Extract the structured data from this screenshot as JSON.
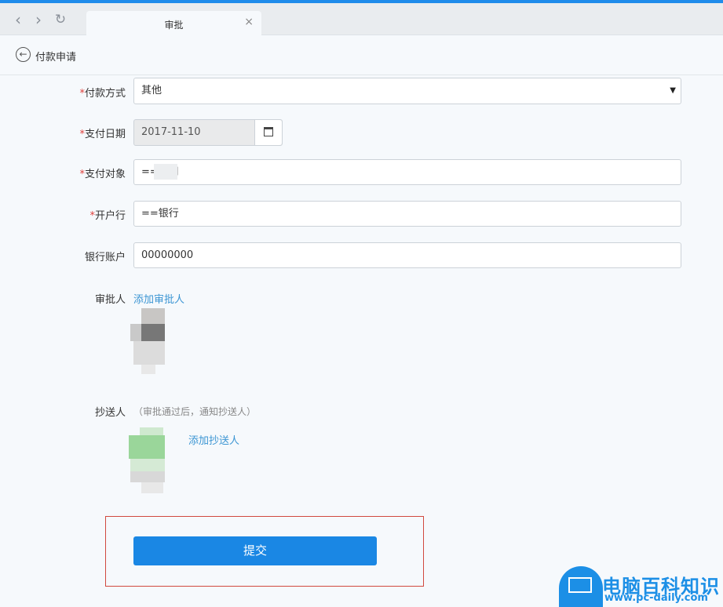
{
  "browser": {
    "tab_title": "审批",
    "tab_close": "×",
    "back_icon": "‹",
    "forward_icon": "›",
    "reload_icon": "↻"
  },
  "header": {
    "title": "付款申请",
    "back_icon": "←"
  },
  "form": {
    "payment_method": {
      "required": "*",
      "label": "付款方式",
      "value": "其他"
    },
    "pay_date": {
      "required": "*",
      "label": "支付日期",
      "value": "2017-11-10"
    },
    "payee": {
      "required": "*",
      "label": "支付对象",
      "value": "==公司"
    },
    "bank": {
      "required": "*",
      "label": "开户行",
      "value": "==银行"
    },
    "account": {
      "label": "银行账户",
      "value": "00000000"
    },
    "approver": {
      "label": "审批人",
      "add_link": "添加审批人"
    },
    "cc": {
      "label": "抄送人",
      "hint": "（审批通过后，通知抄送人）",
      "add_link": "添加抄送人"
    },
    "submit_label": "提交"
  },
  "watermark": {
    "text": "电脑百科知识",
    "url": "www.pc-daily.com"
  },
  "colors": {
    "accent": "#1a87e4",
    "link": "#3b95d3",
    "required": "#e0403c"
  }
}
